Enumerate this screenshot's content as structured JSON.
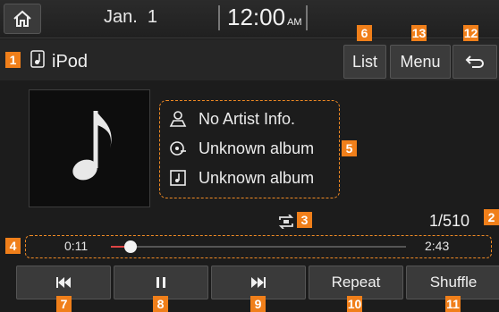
{
  "status": {
    "date": "Jan.  1",
    "time": "12:00",
    "ampm": "AM"
  },
  "source": {
    "title": "iPod"
  },
  "top_buttons": {
    "list": "List",
    "menu": "Menu"
  },
  "track_info": {
    "artist": "No Artist Info.",
    "album": "Unknown album",
    "title": "Unknown album"
  },
  "track_count": "1/510",
  "progress": {
    "elapsed": "0:11",
    "total": "2:43",
    "fraction": 0.067
  },
  "controls": {
    "repeat": "Repeat",
    "shuffle": "Shuffle"
  },
  "callouts": {
    "c1": "1",
    "c2": "2",
    "c3": "3",
    "c4": "4",
    "c5": "5",
    "c6": "6",
    "c7": "7",
    "c8": "8",
    "c9": "9",
    "c10": "10",
    "c11": "11",
    "c12": "12",
    "c13": "13"
  },
  "icons": {
    "home": "home-icon",
    "source": "music-note-icon",
    "back": "back-arrow-icon",
    "art": "music-note-icon",
    "artist": "person-icon",
    "album": "album-icon",
    "title": "song-icon",
    "repeat": "repeat-icon",
    "prev": "skip-previous-icon",
    "pause": "pause-icon",
    "next": "skip-next-icon"
  },
  "colors": {
    "accent": "#f07f1a",
    "background": "#1c1c1c",
    "button": "#3a3a3a"
  }
}
